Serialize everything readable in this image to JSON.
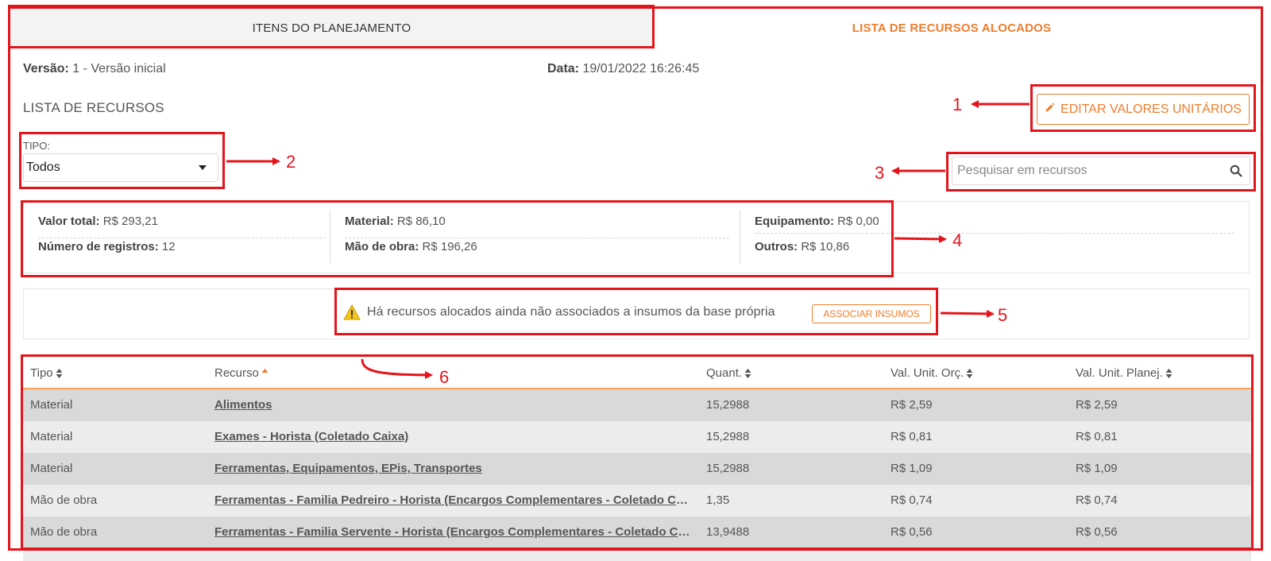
{
  "tabs": [
    {
      "label": "ITENS DO PLANEJAMENTO"
    },
    {
      "label": "LISTA DE RECURSOS ALOCADOS"
    }
  ],
  "meta": {
    "versao_label": "Versão:",
    "versao_value": "1 - Versão inicial",
    "data_label": "Data:",
    "data_value": "19/01/2022 16:26:45"
  },
  "section_title": "LISTA DE RECURSOS",
  "edit_button": {
    "label": "EDITAR VALORES UNITÁRIOS",
    "icon": "pencil-icon"
  },
  "tipo": {
    "label": "TIPO:",
    "selected": "Todos"
  },
  "search": {
    "placeholder": "Pesquisar em recursos",
    "value": "",
    "icon": "search-icon"
  },
  "summary": {
    "valor_total_label": "Valor total:",
    "valor_total": "R$ 293,21",
    "registros_label": "Número de registros:",
    "registros": "12",
    "material_label": "Material:",
    "material": "R$ 86,10",
    "mao_obra_label": "Mão de obra:",
    "mao_obra": "R$ 196,26",
    "equipamento_label": "Equipamento:",
    "equipamento": "R$ 0,00",
    "outros_label": "Outros:",
    "outros": "R$ 10,86"
  },
  "alert": {
    "text": "Há recursos alocados ainda não associados a insumos da base própria",
    "button": "ASSOCIAR INSUMOS",
    "icon": "warning-icon"
  },
  "table": {
    "headers": [
      "Tipo",
      "Recurso",
      "Quant.",
      "Val. Unit. Orç.",
      "Val. Unit. Planej."
    ],
    "rows": [
      [
        "Material",
        "Alimentos",
        "15,2988",
        "R$ 2,59",
        "R$ 2,59"
      ],
      [
        "Material",
        "Exames - Horista (Coletado Caixa)",
        "15,2988",
        "R$ 0,81",
        "R$ 0,81"
      ],
      [
        "Material",
        "Ferramentas, Equipamentos, EPis, Transportes",
        "15,2988",
        "R$ 1,09",
        "R$ 1,09"
      ],
      [
        "Mão de obra",
        "Ferramentas - Familia Pedreiro - Horista (Encargos Complementares - Coletado Caixa)",
        "1,35",
        "R$ 0,74",
        "R$ 0,74"
      ],
      [
        "Mão de obra",
        "Ferramentas - Familia Servente - Horista (Encargos Complementares - Coletado Caixa)",
        "13,9488",
        "R$ 0,56",
        "R$ 0,56"
      ]
    ]
  },
  "annotations": [
    "1",
    "2",
    "3",
    "4",
    "5",
    "6"
  ],
  "colors": {
    "accent": "#f07d2c",
    "annotation": "#e4141b"
  }
}
